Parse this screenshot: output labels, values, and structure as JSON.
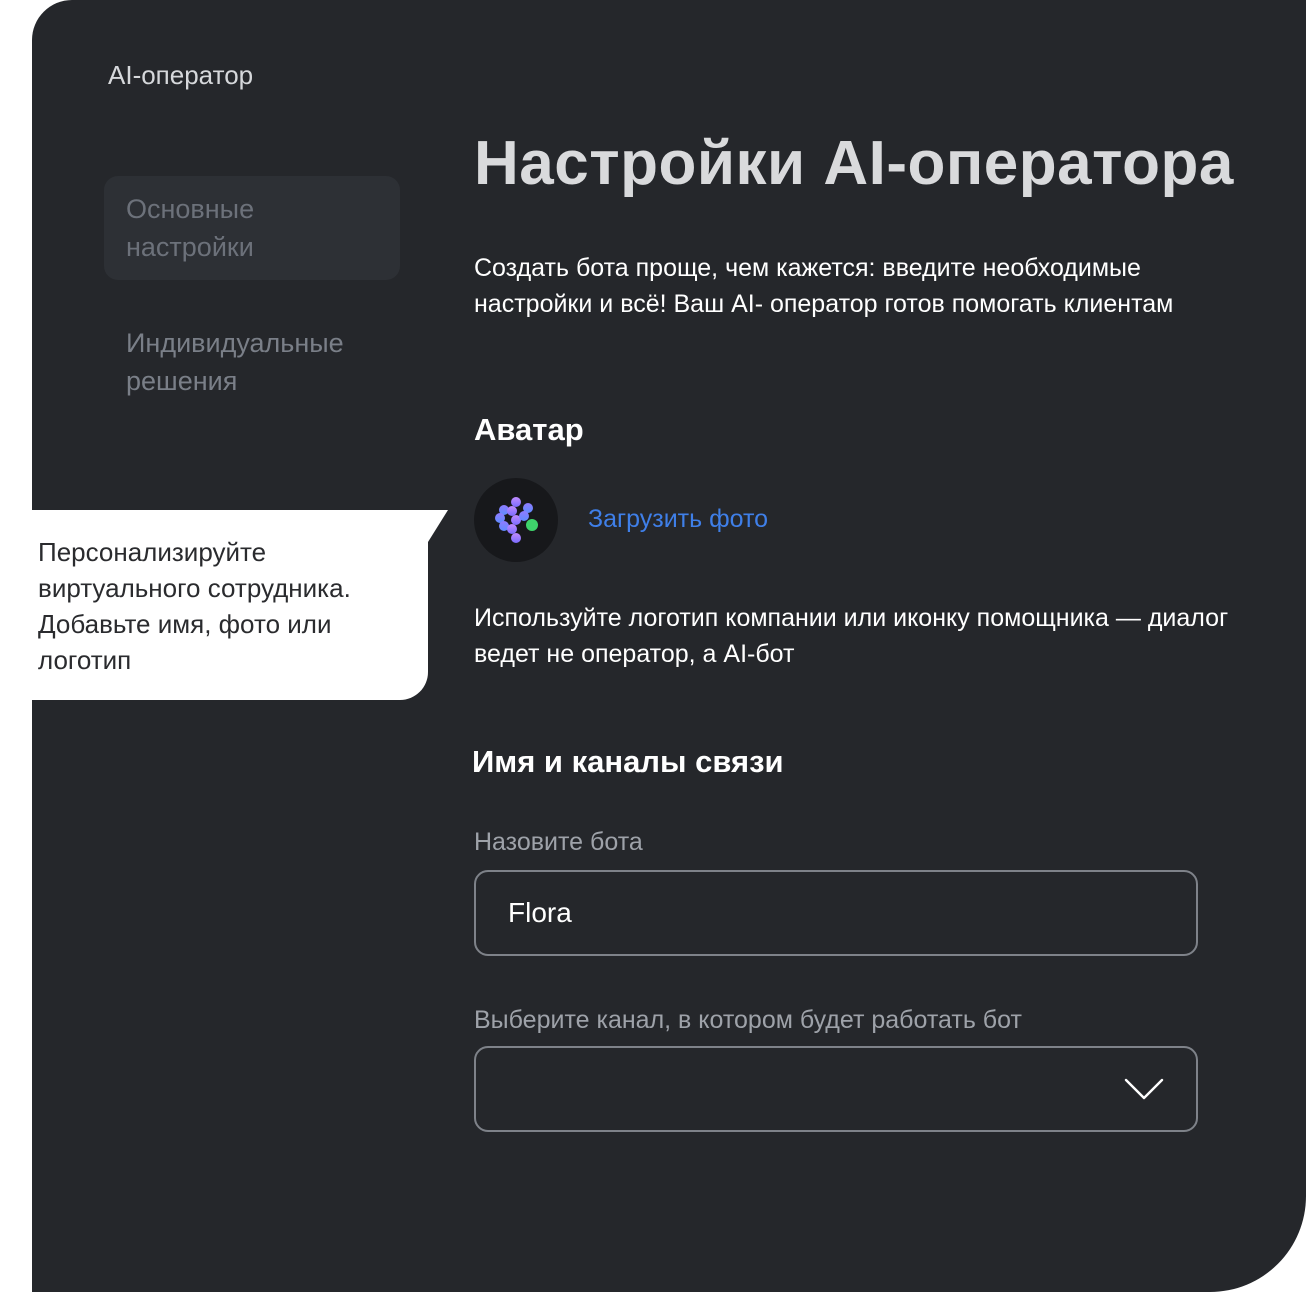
{
  "sidebar": {
    "app_title": "AI-оператор",
    "items": [
      {
        "label": "Основные настройки",
        "active": true
      },
      {
        "label": "Индивидуальные решения",
        "active": false
      }
    ]
  },
  "main": {
    "title": "Настройки AI-оператора",
    "intro": "Создать бота проще, чем кажется: введите необходимые настройки и всё! Ваш AI- оператор готов помогать клиентам",
    "avatar_section": {
      "title": "Аватар",
      "avatar_icon": "ai-bot-logo-icon",
      "upload_label": "Загрузить фото",
      "hint": "Используйте логотип компании или иконку помощника — диалог ведет не оператор, а AI-бот"
    },
    "name_section": {
      "title": "Имя и каналы связи",
      "name_label": "Назовите бота",
      "name_value": "Flora",
      "channel_label": "Выберите канал, в котором будет работать бот",
      "channel_value": "",
      "channel_icon": "chevron-down-icon"
    }
  },
  "tooltip": {
    "text": "Персонализируйте виртуального сотрудника. Добавьте имя, фото или логотип"
  },
  "colors": {
    "panel_bg": "#25272b",
    "link": "#3f7fe8",
    "muted": "#6c717a",
    "field_border": "#7e8289"
  }
}
